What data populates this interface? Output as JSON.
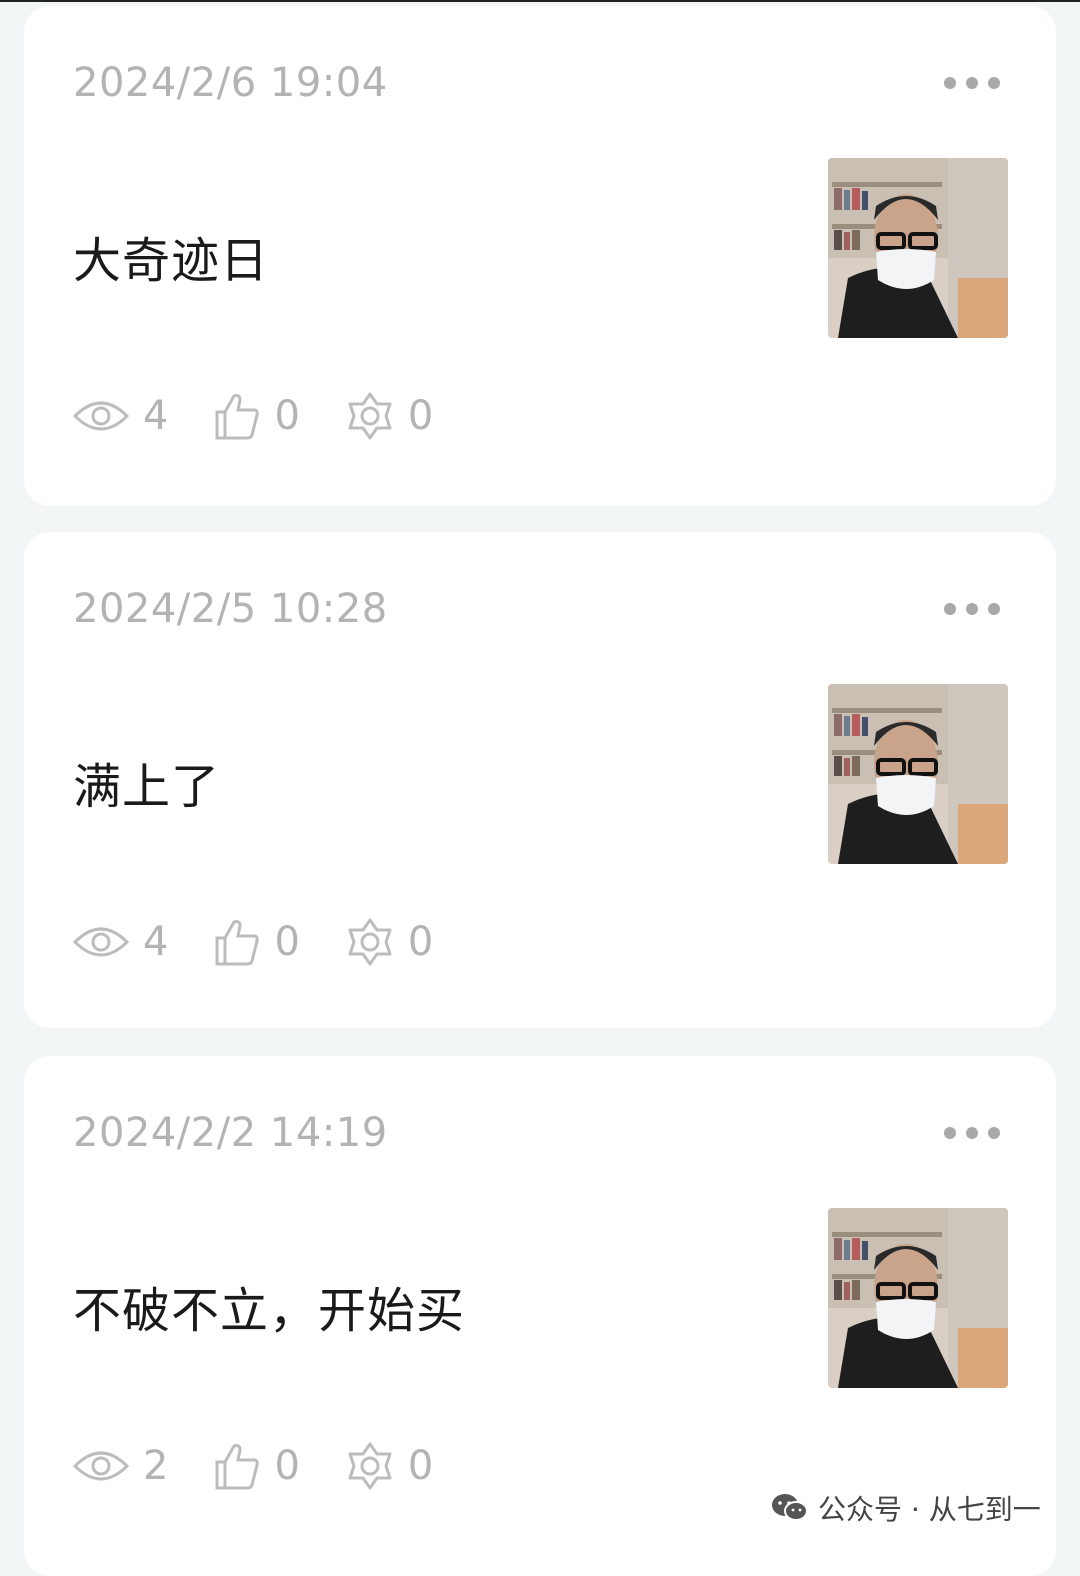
{
  "posts": [
    {
      "date": "2024/2/6 19:04",
      "text": "大奇迹日",
      "views": "4",
      "likes": "0",
      "shares": "0"
    },
    {
      "date": "2024/2/5 10:28",
      "text": "满上了",
      "views": "4",
      "likes": "0",
      "shares": "0"
    },
    {
      "date": "2024/2/2 14:19",
      "text": "不破不立，开始买",
      "views": "2",
      "likes": "0",
      "shares": "0"
    }
  ],
  "icons": {
    "more": "more-dots-icon",
    "views": "eye-icon",
    "likes": "thumbs-up-icon",
    "shares": "share-star-icon",
    "watermark": "wechat-icon"
  },
  "watermark": {
    "text": "公众号 · 从七到一"
  },
  "colors": {
    "background": "#f3f6f6",
    "card": "#ffffff",
    "muted": "#b3b3b3",
    "text": "#1a1a1a"
  }
}
